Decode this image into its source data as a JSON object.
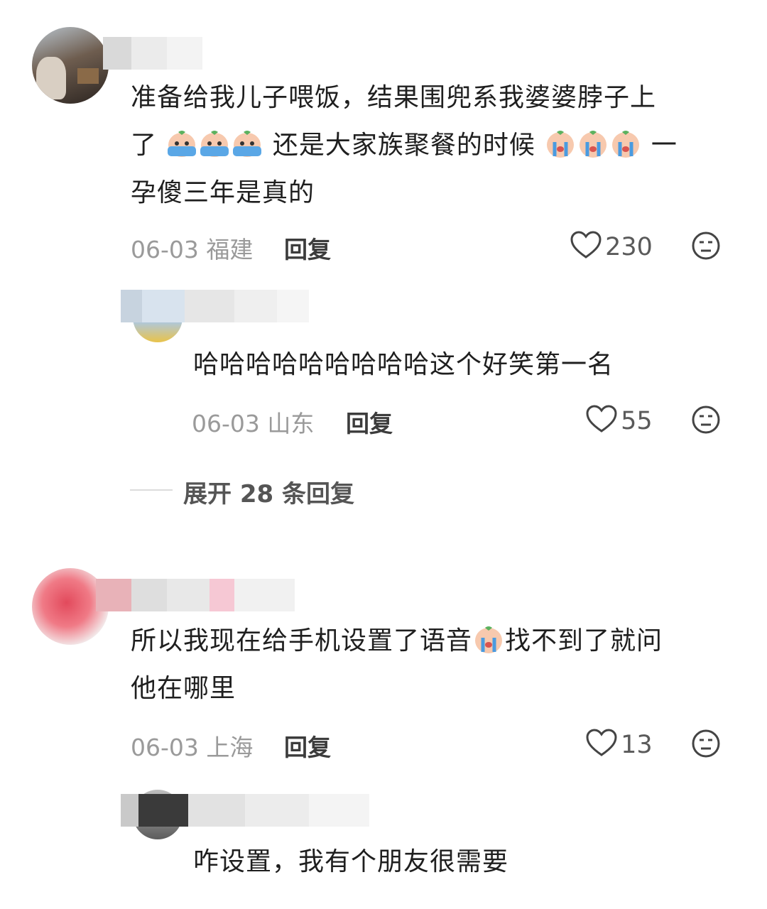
{
  "comments": [
    {
      "text_line1": "准备给我儿子喂饭，结果围兜系我婆婆脖子上",
      "text_line2_a": "了",
      "text_line2_b": "还是大家族聚餐的时候",
      "text_line2_c": "一",
      "text_line3": "孕傻三年是真的",
      "date": "06-03",
      "location": "福建",
      "reply_label": "回复",
      "likes": "230"
    },
    {
      "text": "哈哈哈哈哈哈哈哈哈这个好笑第一名",
      "date": "06-03",
      "location": "山东",
      "reply_label": "回复",
      "likes": "55"
    },
    {
      "text_line1_a": "所以我现在给手机设置了语音",
      "text_line1_b": "找不到了就问",
      "text_line2": "他在哪里",
      "date": "06-03",
      "location": "上海",
      "reply_label": "回复",
      "likes": "13"
    },
    {
      "text": "咋设置，我有个朋友很需要"
    }
  ],
  "expand_replies": "展开 28 条回复",
  "icons": {
    "heart": "heart-icon",
    "dislike": "dislike-face-icon",
    "emoji_sob": "crying-emoji-icon",
    "emoji_crying_face": "crying-face-emoji-icon"
  }
}
